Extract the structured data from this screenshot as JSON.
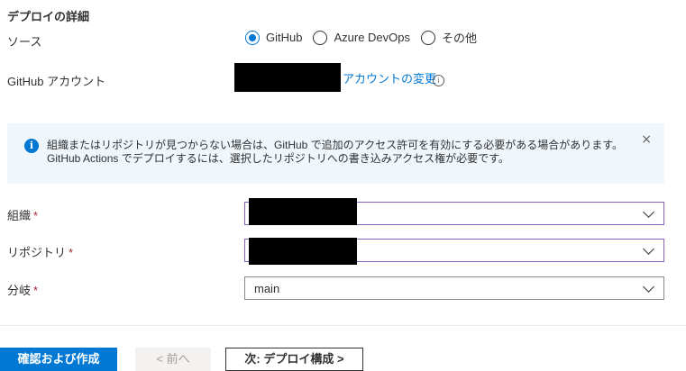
{
  "section_title": "デプロイの詳細",
  "source": {
    "label": "ソース",
    "options": [
      {
        "label": "GitHub",
        "checked": true
      },
      {
        "label": "Azure DevOps",
        "checked": false
      },
      {
        "label": "その他",
        "checked": false
      }
    ]
  },
  "github_account": {
    "label": "GitHub アカウント",
    "change_link": "アカウントの変更",
    "info_icon": "i"
  },
  "banner": {
    "icon": "i",
    "text": "組織またはリポジトリが見つからない場合は、GitHub で追加のアクセス許可を有効にする必要がある場合があります。GitHub Actions でデプロイするには、選択したリポジトリへの書き込みアクセス権が必要です。",
    "close": "×"
  },
  "fields": {
    "organization": {
      "label": "組織",
      "required": "*",
      "value": ""
    },
    "repository": {
      "label": "リポジトリ",
      "required": "*",
      "value": ""
    },
    "branch": {
      "label": "分岐",
      "required": "*",
      "value": "main"
    }
  },
  "buttons": {
    "review_create": "確認および作成",
    "previous": "< 前へ",
    "next": "次: デプロイ構成 >"
  },
  "colors": {
    "accent": "#0078d4",
    "focus_border": "#8764b8",
    "required": "#a4262c",
    "banner_bg": "#eff6fc"
  }
}
